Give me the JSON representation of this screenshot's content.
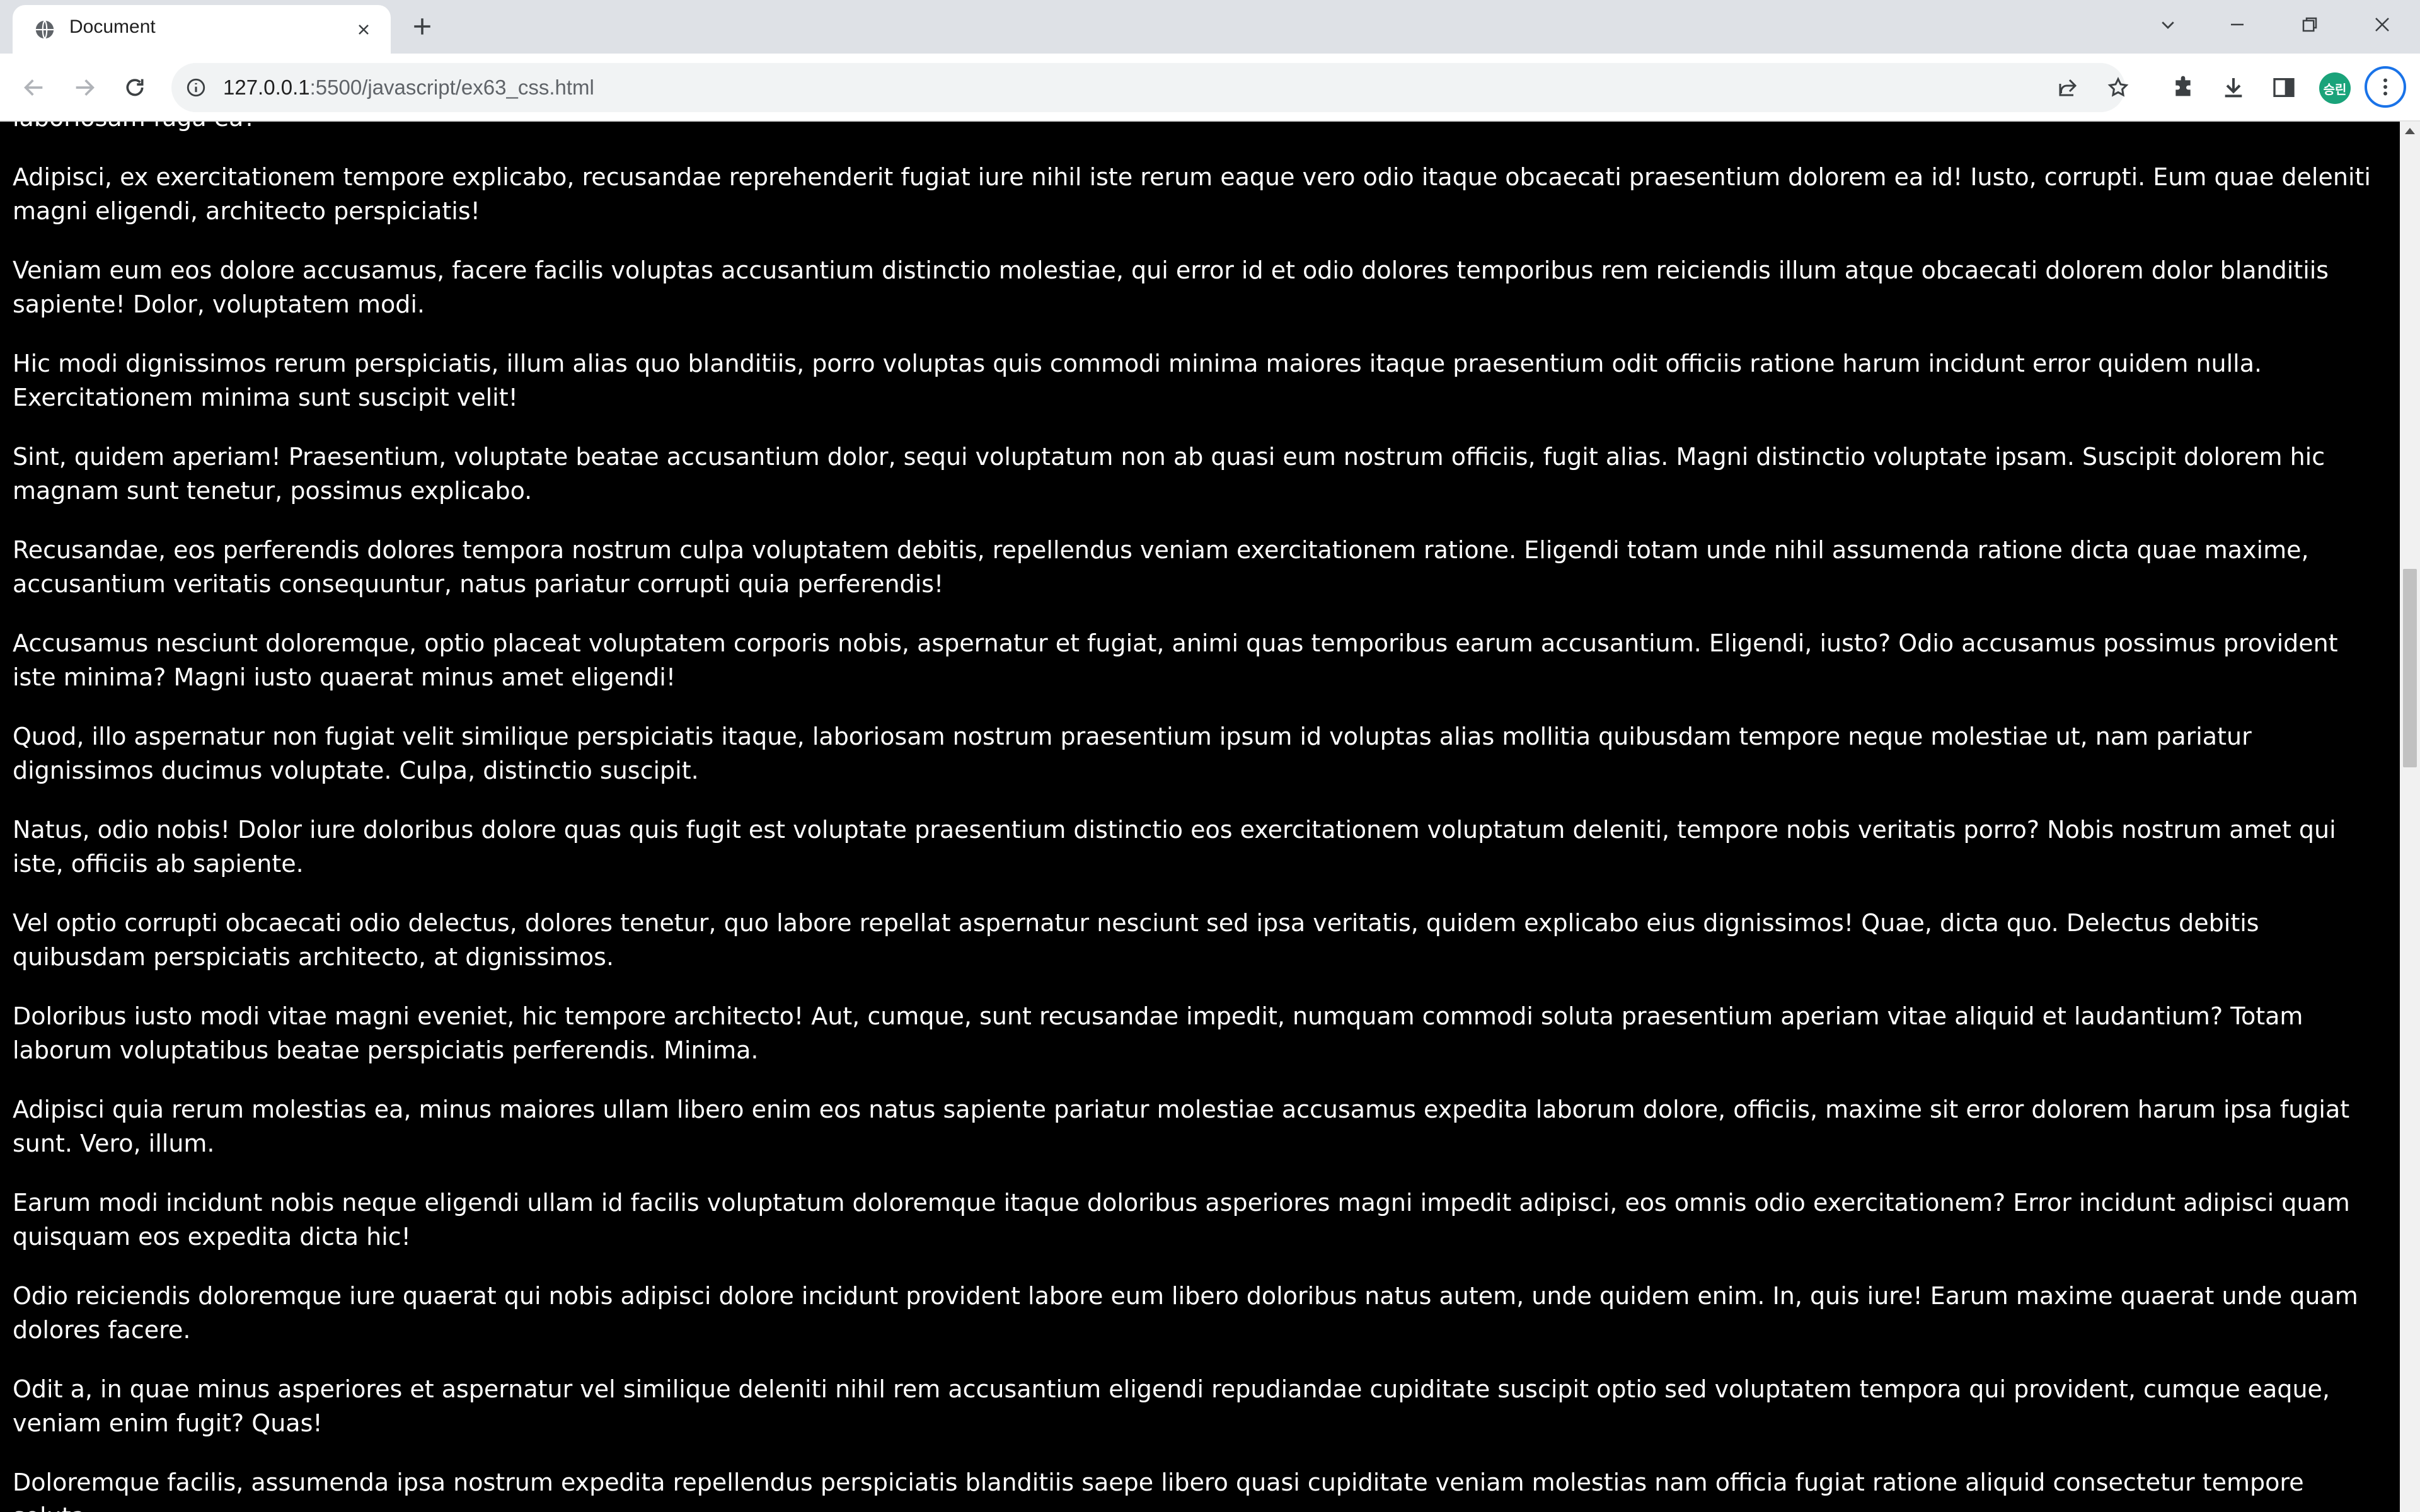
{
  "browser": {
    "tab": {
      "title": "Document"
    },
    "address": {
      "host": "127.0.0.1",
      "path": ":5500/javascript/ex63_css.html"
    },
    "profile_initials": "승린",
    "colors": {
      "tabstrip": "#dee1e6",
      "toolbar": "#ffffff",
      "omnibox": "#f1f3f4",
      "accent": "#1a73e8",
      "avatar": "#1aa37a"
    }
  },
  "page": {
    "background": "#000000",
    "text_color": "#ffffff",
    "paragraphs": [
      "Voluptas quaerat eveniet doloribus quos officiis perspiciatis voluptate ex sed eum ipsum quia nesciunt, molestias velit quasi vitae possimus ratione maiores, delectus quo architecto, incidunt laboriosam fuga ea?",
      "Adipisci, ex exercitationem tempore explicabo, recusandae reprehenderit fugiat iure nihil iste rerum eaque vero odio itaque obcaecati praesentium dolorem ea id! Iusto, corrupti. Eum quae deleniti magni eligendi, architecto perspiciatis!",
      "Veniam eum eos dolore accusamus, facere facilis voluptas accusantium distinctio molestiae, qui error id et odio dolores temporibus rem reiciendis illum atque obcaecati dolorem dolor blanditiis sapiente! Dolor, voluptatem modi.",
      "Hic modi dignissimos rerum perspiciatis, illum alias quo blanditiis, porro voluptas quis commodi minima maiores itaque praesentium odit officiis ratione harum incidunt error quidem nulla. Exercitationem minima sunt suscipit velit!",
      "Sint, quidem aperiam! Praesentium, voluptate beatae accusantium dolor, sequi voluptatum non ab quasi eum nostrum officiis, fugit alias. Magni distinctio voluptate ipsam. Suscipit dolorem hic magnam sunt tenetur, possimus explicabo.",
      "Recusandae, eos perferendis dolores tempora nostrum culpa voluptatem debitis, repellendus veniam exercitationem ratione. Eligendi totam unde nihil assumenda ratione dicta quae maxime, accusantium veritatis consequuntur, natus pariatur corrupti quia perferendis!",
      "Accusamus nesciunt doloremque, optio placeat voluptatem corporis nobis, aspernatur et fugiat, animi quas temporibus earum accusantium. Eligendi, iusto? Odio accusamus possimus provident iste minima? Magni iusto quaerat minus amet eligendi!",
      "Quod, illo aspernatur non fugiat velit similique perspiciatis itaque, laboriosam nostrum praesentium ipsum id voluptas alias mollitia quibusdam tempore neque molestiae ut, nam pariatur dignissimos ducimus voluptate. Culpa, distinctio suscipit.",
      "Natus, odio nobis! Dolor iure doloribus dolore quas quis fugit est voluptate praesentium distinctio eos exercitationem voluptatum deleniti, tempore nobis veritatis porro? Nobis nostrum amet qui iste, officiis ab sapiente.",
      "Vel optio corrupti obcaecati odio delectus, dolores tenetur, quo labore repellat aspernatur nesciunt sed ipsa veritatis, quidem explicabo eius dignissimos! Quae, dicta quo. Delectus debitis quibusdam perspiciatis architecto, at dignissimos.",
      "Doloribus iusto modi vitae magni eveniet, hic tempore architecto! Aut, cumque, sunt recusandae impedit, numquam commodi soluta praesentium aperiam vitae aliquid et laudantium? Totam laborum voluptatibus beatae perspiciatis perferendis. Minima.",
      "Adipisci quia rerum molestias ea, minus maiores ullam libero enim eos natus sapiente pariatur molestiae accusamus expedita laborum dolore, officiis, maxime sit error dolorem harum ipsa fugiat sunt. Vero, illum.",
      "Earum modi incidunt nobis neque eligendi ullam id facilis voluptatum doloremque itaque doloribus asperiores magni impedit adipisci, eos omnis odio exercitationem? Error incidunt adipisci quam quisquam eos expedita dicta hic!",
      "Odio reiciendis doloremque iure quaerat qui nobis adipisci dolore incidunt provident labore eum libero doloribus natus autem, unde quidem enim. In, quis iure! Earum maxime quaerat unde quam dolores facere.",
      "Odit a, in quae minus asperiores et aspernatur vel similique deleniti nihil rem accusantium eligendi repudiandae cupiditate suscipit optio sed voluptatem tempora qui provident, cumque eaque, veniam enim fugit? Quas!",
      "Doloremque facilis, assumenda ipsa nostrum expedita repellendus perspiciatis blanditiis saepe libero quasi cupiditate veniam molestias nam officia fugiat ratione aliquid consectetur tempore soluta."
    ]
  }
}
